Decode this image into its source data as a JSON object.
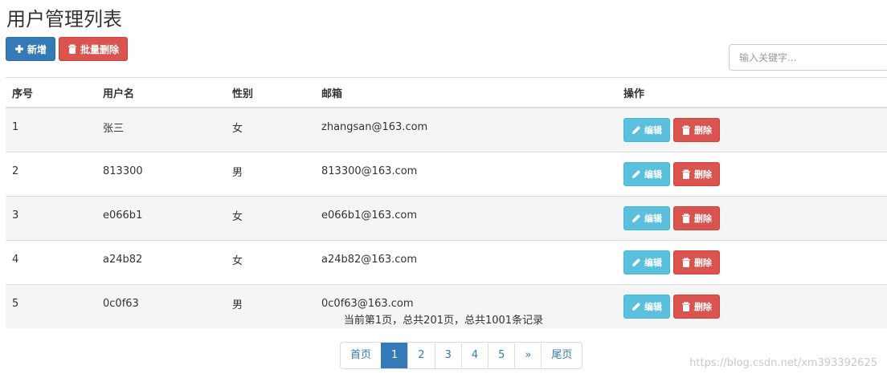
{
  "page": {
    "title": "用户管理列表"
  },
  "toolbar": {
    "add_label": "新增",
    "batch_delete_label": "批量删除"
  },
  "search": {
    "placeholder": "输入关键字..."
  },
  "table": {
    "headers": {
      "id": "序号",
      "username": "用户名",
      "gender": "性别",
      "email": "邮箱",
      "actions": "操作"
    },
    "rows": [
      {
        "id": "1",
        "username": "张三",
        "gender": "女",
        "email": "zhangsan@163.com",
        "edit": "编辑",
        "delete": "删除"
      },
      {
        "id": "2",
        "username": "813300",
        "gender": "男",
        "email": "813300@163.com",
        "edit": "编辑",
        "delete": "删除"
      },
      {
        "id": "3",
        "username": "e066b1",
        "gender": "女",
        "email": "e066b1@163.com",
        "edit": "编辑",
        "delete": "删除"
      },
      {
        "id": "4",
        "username": "a24b82",
        "gender": "女",
        "email": "a24b82@163.com",
        "edit": "编辑",
        "delete": "删除"
      },
      {
        "id": "5",
        "username": "0c0f63",
        "gender": "男",
        "email": "0c0f63@163.com",
        "edit": "编辑",
        "delete": "删除"
      }
    ]
  },
  "pagination": {
    "info": "当前第1页，总共201页，总共1001条记录",
    "first": "首页",
    "pages": [
      "1",
      "2",
      "3",
      "4",
      "5"
    ],
    "next": "»",
    "last": "尾页",
    "active_page": "1"
  },
  "watermark": "https://blog.csdn.net/xm393392625",
  "colors": {
    "primary": "#337ab7",
    "danger": "#d9534f",
    "info": "#5bc0de"
  },
  "icons": {
    "add": "plus-icon",
    "delete": "trash-icon",
    "edit": "pencil-icon"
  }
}
